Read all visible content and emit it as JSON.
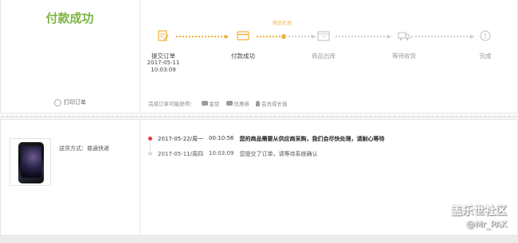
{
  "status": {
    "title": "付款成功",
    "print_label": "打印订单"
  },
  "progress": {
    "in_transit_label": "商品在途",
    "steps": [
      {
        "label": "提交订单",
        "date": "2017-05-11",
        "time": "10:03:09",
        "icon": "order-submit-icon",
        "done": true
      },
      {
        "label": "付款成功",
        "icon": "payment-card-icon",
        "done": true
      },
      {
        "label": "商品出库",
        "icon": "warehouse-icon",
        "done": false
      },
      {
        "label": "等待收货",
        "icon": "delivery-truck-icon",
        "done": false
      },
      {
        "label": "完成",
        "icon": "complete-icon",
        "done": false
      }
    ]
  },
  "rewards": {
    "prefix": "完成订单可能获得：",
    "items": [
      {
        "label": "金豆",
        "icon": "coins-icon"
      },
      {
        "label": "优惠券",
        "icon": "coupon-icon"
      },
      {
        "label": "会员成长值",
        "icon": "member-icon"
      }
    ]
  },
  "order": {
    "shipping": "送货方式：普通快递"
  },
  "logs": [
    {
      "date": "2017-05-22/周一",
      "time": "00:10:56",
      "message": "您的商品需要从供应商采购，我们会尽快处理，请耐心等待"
    },
    {
      "date": "2017-05-11/周四",
      "time": "10:03:09",
      "message": "您提交了订单，请等待系统确认"
    }
  ],
  "watermark": {
    "line1": "盖乐世社区",
    "line2": "@Mr_PAK"
  },
  "colors": {
    "success": "#7cb342",
    "accent": "#f0b23c",
    "log_dot": "#e53935"
  }
}
